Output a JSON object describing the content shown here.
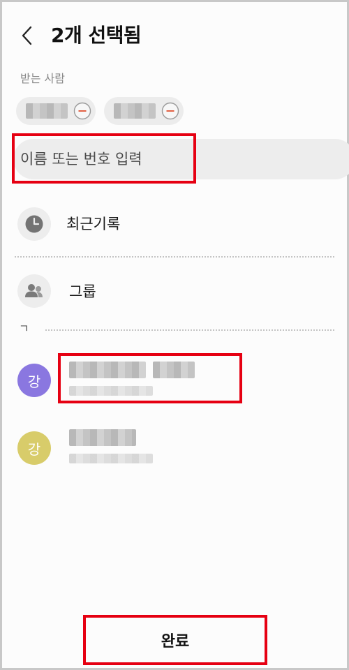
{
  "header": {
    "title": "2개 선택됨",
    "back_icon": "chevron-left-icon"
  },
  "recipients": {
    "label": "받는 사람",
    "chip_count": 2,
    "remove_icon": "minus-circle-icon"
  },
  "search": {
    "placeholder": "이름 또는 번호 입력",
    "value": ""
  },
  "menu": {
    "recent": {
      "label": "최근기록",
      "icon": "clock-icon"
    },
    "group": {
      "label": "그룹",
      "icon": "people-icon"
    }
  },
  "index_header": "ㄱ",
  "contacts": [
    {
      "initial": "강",
      "avatar_color": "#8a77e0"
    },
    {
      "initial": "강",
      "avatar_color": "#d8cc6a"
    }
  ],
  "footer": {
    "done_label": "완료"
  },
  "colors": {
    "highlight": "#e60012",
    "remove_accent": "#e0502f"
  }
}
